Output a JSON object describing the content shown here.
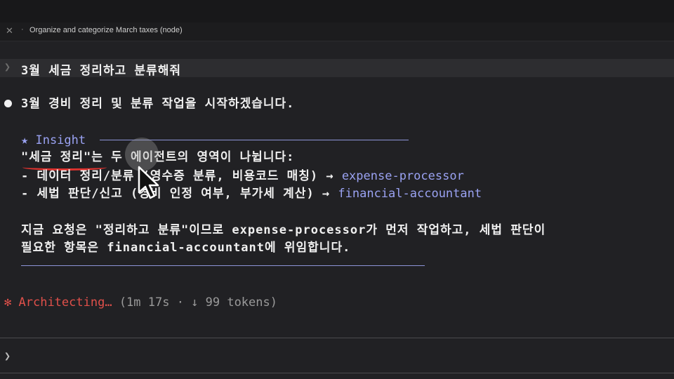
{
  "tab": {
    "close_glyph": "✕",
    "dot": "·",
    "title": "Organize and categorize March taxes (node)"
  },
  "prompt": {
    "glyph": "❯",
    "text": "3월 세금 정리하고 분류해줘"
  },
  "response": {
    "intro": "3월 경비 정리 및 분류 작업을 시작하겠습니다.",
    "insight": {
      "title": "★ Insight",
      "line1": "\"세금 정리\"는 두 에이전트의 영역이 나뉩니다:",
      "item1_text": "- 데이터 정리/분류 (영수증 분류, 비용코드 매칭) → ",
      "item1_agent": "expense-processor",
      "item2_text": "- 세법 판단/신고 (경비 인정 여부, 부가세 계산) → ",
      "item2_agent": "financial-accountant",
      "para_line1": "지금 요청은 \"정리하고 분류\"이므로 expense-processor가 먼저 작업하고, 세법 판단이",
      "para_line2": "필요한 항목은 financial-accountant에 위임합니다."
    }
  },
  "status": {
    "glyph": "✻",
    "label": "Architecting…",
    "meta": "(1m 17s · ↓ 99 tokens)"
  },
  "input": {
    "glyph": "❯"
  },
  "colors": {
    "accent": "#9aa2f2",
    "status": "#e0504a",
    "annotation": "#e0332f"
  },
  "icons": {
    "cursor": "mouse-pointer-icon"
  }
}
